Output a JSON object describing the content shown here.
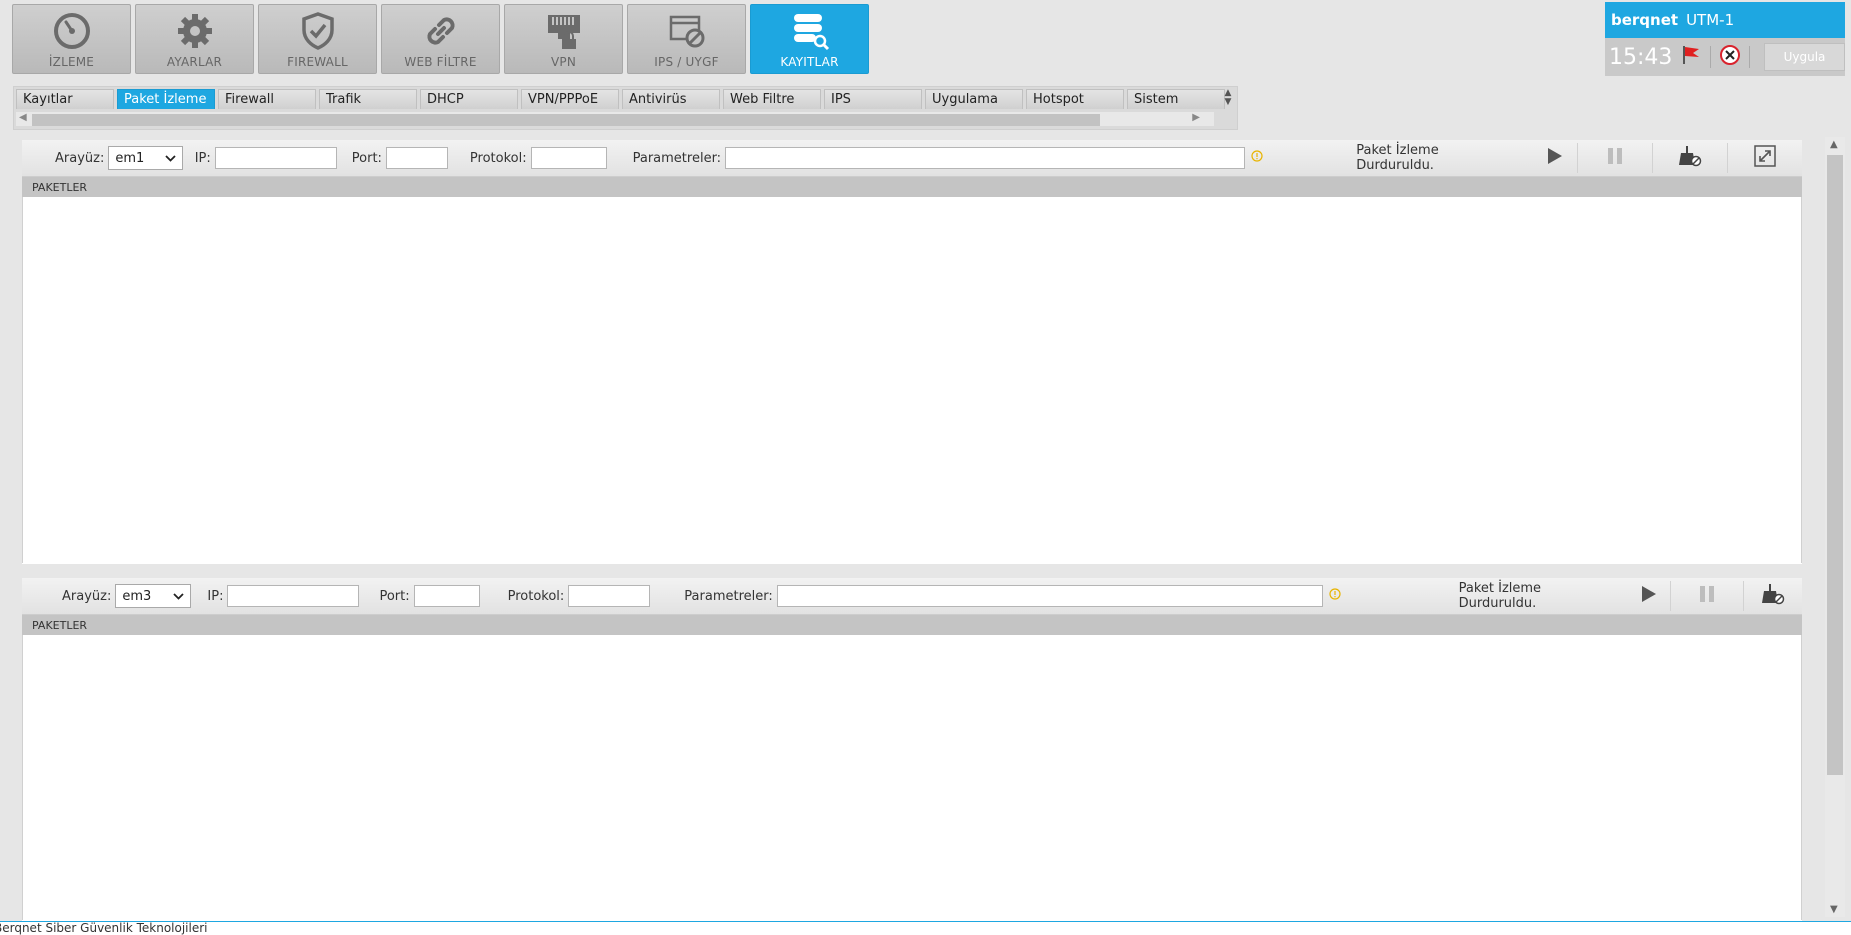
{
  "nav": {
    "items": [
      {
        "label": "İZLEME",
        "icon": "gauge-icon"
      },
      {
        "label": "AYARLAR",
        "icon": "gear-icon"
      },
      {
        "label": "FIREWALL",
        "icon": "shield-icon"
      },
      {
        "label": "WEB FİLTRE",
        "icon": "link-icon"
      },
      {
        "label": "VPN",
        "icon": "network-lock-icon"
      },
      {
        "label": "IPS / UYGF",
        "icon": "window-block-icon"
      },
      {
        "label": "KAYITLAR",
        "icon": "database-search-icon",
        "active": true
      }
    ]
  },
  "brand": {
    "logo": "berqnet",
    "device": "UTM-1",
    "clock": "15:43",
    "apply_label": "Uygula",
    "flag_icon": "flag-icon",
    "close_icon": "close-circle-icon"
  },
  "tabs": {
    "items": [
      "Kayıtlar",
      "Paket İzleme",
      "Firewall",
      "Trafik",
      "DHCP",
      "VPN/PPPoE",
      "Antivirüs",
      "Web Filtre",
      "IPS",
      "Uygulama",
      "Hotspot",
      "Sistem"
    ],
    "active_index": 1
  },
  "panel1": {
    "interface_label": "Arayüz:",
    "interface_value": "em1",
    "ip_label": "IP:",
    "ip_value": "",
    "port_label": "Port:",
    "port_value": "",
    "protocol_label": "Protokol:",
    "protocol_value": "",
    "params_label": "Parametreler:",
    "params_value": "",
    "status": "Paket İzleme Durduruldu.",
    "section": "PAKETLER"
  },
  "panel2": {
    "interface_label": "Arayüz:",
    "interface_value": "em3",
    "ip_label": "IP:",
    "ip_value": "",
    "port_label": "Port:",
    "port_value": "",
    "protocol_label": "Protokol:",
    "protocol_value": "",
    "params_label": "Parametreler:",
    "params_value": "",
    "status": "Paket İzleme Durduruldu.",
    "section": "PAKETLER"
  },
  "footer": {
    "text": "Berqnet Siber Güvenlik Teknolojileri"
  },
  "colors": {
    "accent": "#1ea7e1",
    "warning": "#e8b400",
    "flag": "#e02020",
    "close": "#d9232d"
  }
}
